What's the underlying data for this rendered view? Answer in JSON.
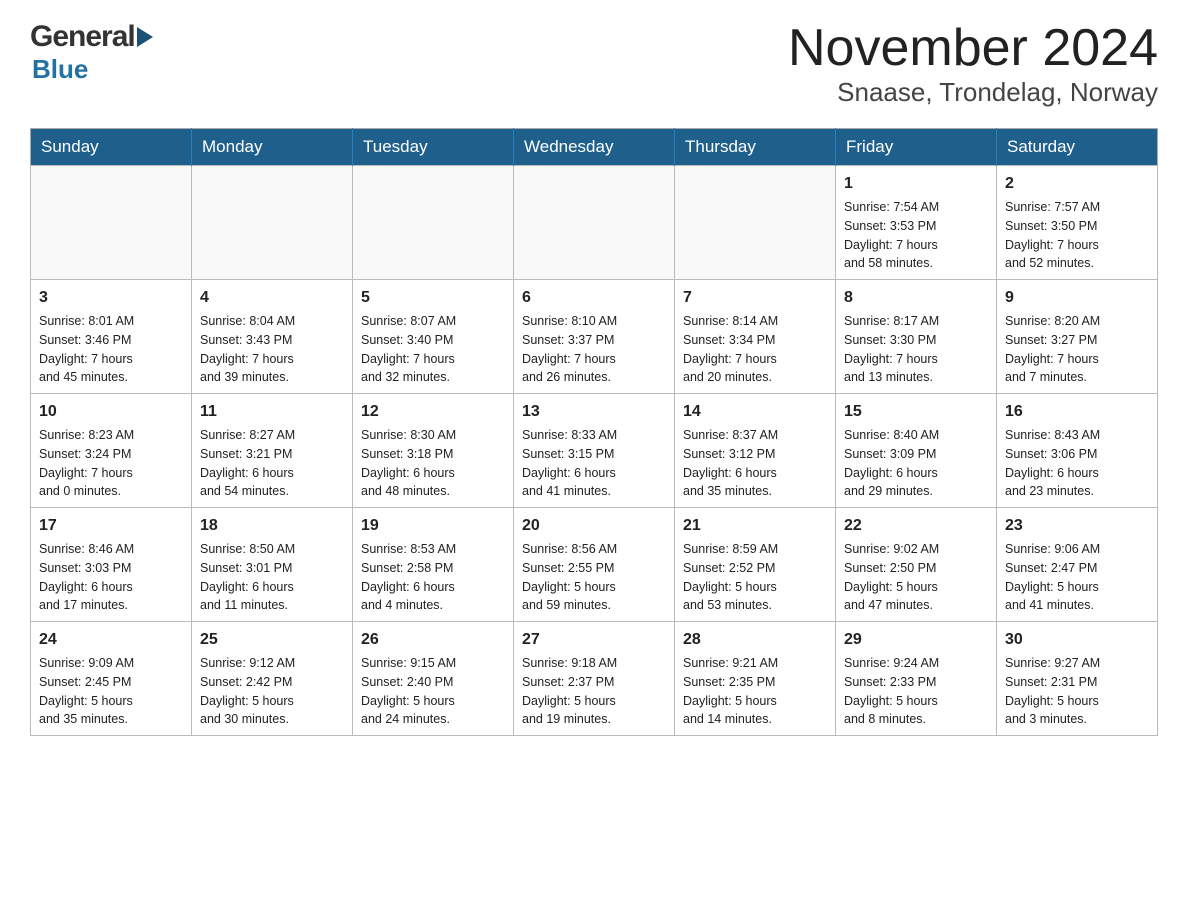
{
  "logo": {
    "general": "General",
    "blue": "Blue"
  },
  "title": "November 2024",
  "subtitle": "Snaase, Trondelag, Norway",
  "days": [
    "Sunday",
    "Monday",
    "Tuesday",
    "Wednesday",
    "Thursday",
    "Friday",
    "Saturday"
  ],
  "weeks": [
    [
      {
        "num": "",
        "info": ""
      },
      {
        "num": "",
        "info": ""
      },
      {
        "num": "",
        "info": ""
      },
      {
        "num": "",
        "info": ""
      },
      {
        "num": "",
        "info": ""
      },
      {
        "num": "1",
        "info": "Sunrise: 7:54 AM\nSunset: 3:53 PM\nDaylight: 7 hours\nand 58 minutes."
      },
      {
        "num": "2",
        "info": "Sunrise: 7:57 AM\nSunset: 3:50 PM\nDaylight: 7 hours\nand 52 minutes."
      }
    ],
    [
      {
        "num": "3",
        "info": "Sunrise: 8:01 AM\nSunset: 3:46 PM\nDaylight: 7 hours\nand 45 minutes."
      },
      {
        "num": "4",
        "info": "Sunrise: 8:04 AM\nSunset: 3:43 PM\nDaylight: 7 hours\nand 39 minutes."
      },
      {
        "num": "5",
        "info": "Sunrise: 8:07 AM\nSunset: 3:40 PM\nDaylight: 7 hours\nand 32 minutes."
      },
      {
        "num": "6",
        "info": "Sunrise: 8:10 AM\nSunset: 3:37 PM\nDaylight: 7 hours\nand 26 minutes."
      },
      {
        "num": "7",
        "info": "Sunrise: 8:14 AM\nSunset: 3:34 PM\nDaylight: 7 hours\nand 20 minutes."
      },
      {
        "num": "8",
        "info": "Sunrise: 8:17 AM\nSunset: 3:30 PM\nDaylight: 7 hours\nand 13 minutes."
      },
      {
        "num": "9",
        "info": "Sunrise: 8:20 AM\nSunset: 3:27 PM\nDaylight: 7 hours\nand 7 minutes."
      }
    ],
    [
      {
        "num": "10",
        "info": "Sunrise: 8:23 AM\nSunset: 3:24 PM\nDaylight: 7 hours\nand 0 minutes."
      },
      {
        "num": "11",
        "info": "Sunrise: 8:27 AM\nSunset: 3:21 PM\nDaylight: 6 hours\nand 54 minutes."
      },
      {
        "num": "12",
        "info": "Sunrise: 8:30 AM\nSunset: 3:18 PM\nDaylight: 6 hours\nand 48 minutes."
      },
      {
        "num": "13",
        "info": "Sunrise: 8:33 AM\nSunset: 3:15 PM\nDaylight: 6 hours\nand 41 minutes."
      },
      {
        "num": "14",
        "info": "Sunrise: 8:37 AM\nSunset: 3:12 PM\nDaylight: 6 hours\nand 35 minutes."
      },
      {
        "num": "15",
        "info": "Sunrise: 8:40 AM\nSunset: 3:09 PM\nDaylight: 6 hours\nand 29 minutes."
      },
      {
        "num": "16",
        "info": "Sunrise: 8:43 AM\nSunset: 3:06 PM\nDaylight: 6 hours\nand 23 minutes."
      }
    ],
    [
      {
        "num": "17",
        "info": "Sunrise: 8:46 AM\nSunset: 3:03 PM\nDaylight: 6 hours\nand 17 minutes."
      },
      {
        "num": "18",
        "info": "Sunrise: 8:50 AM\nSunset: 3:01 PM\nDaylight: 6 hours\nand 11 minutes."
      },
      {
        "num": "19",
        "info": "Sunrise: 8:53 AM\nSunset: 2:58 PM\nDaylight: 6 hours\nand 4 minutes."
      },
      {
        "num": "20",
        "info": "Sunrise: 8:56 AM\nSunset: 2:55 PM\nDaylight: 5 hours\nand 59 minutes."
      },
      {
        "num": "21",
        "info": "Sunrise: 8:59 AM\nSunset: 2:52 PM\nDaylight: 5 hours\nand 53 minutes."
      },
      {
        "num": "22",
        "info": "Sunrise: 9:02 AM\nSunset: 2:50 PM\nDaylight: 5 hours\nand 47 minutes."
      },
      {
        "num": "23",
        "info": "Sunrise: 9:06 AM\nSunset: 2:47 PM\nDaylight: 5 hours\nand 41 minutes."
      }
    ],
    [
      {
        "num": "24",
        "info": "Sunrise: 9:09 AM\nSunset: 2:45 PM\nDaylight: 5 hours\nand 35 minutes."
      },
      {
        "num": "25",
        "info": "Sunrise: 9:12 AM\nSunset: 2:42 PM\nDaylight: 5 hours\nand 30 minutes."
      },
      {
        "num": "26",
        "info": "Sunrise: 9:15 AM\nSunset: 2:40 PM\nDaylight: 5 hours\nand 24 minutes."
      },
      {
        "num": "27",
        "info": "Sunrise: 9:18 AM\nSunset: 2:37 PM\nDaylight: 5 hours\nand 19 minutes."
      },
      {
        "num": "28",
        "info": "Sunrise: 9:21 AM\nSunset: 2:35 PM\nDaylight: 5 hours\nand 14 minutes."
      },
      {
        "num": "29",
        "info": "Sunrise: 9:24 AM\nSunset: 2:33 PM\nDaylight: 5 hours\nand 8 minutes."
      },
      {
        "num": "30",
        "info": "Sunrise: 9:27 AM\nSunset: 2:31 PM\nDaylight: 5 hours\nand 3 minutes."
      }
    ]
  ]
}
